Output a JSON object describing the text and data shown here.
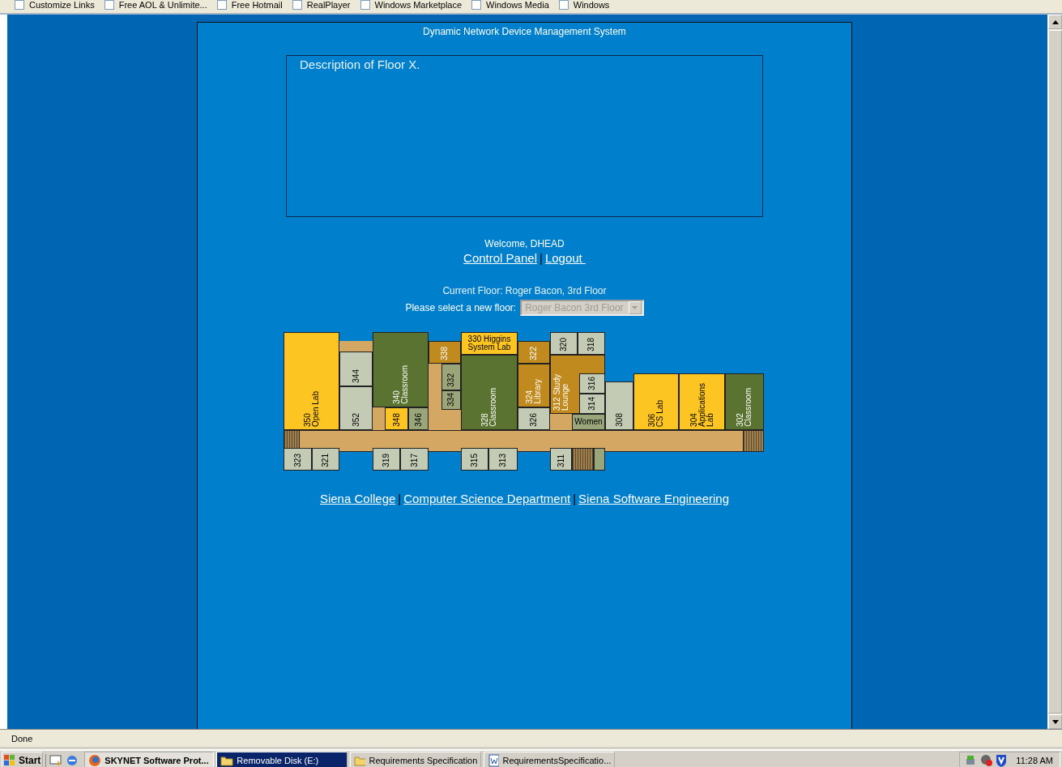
{
  "links_bar": [
    {
      "label": "Customize Links"
    },
    {
      "label": "Free AOL & Unlimite..."
    },
    {
      "label": "Free Hotmail"
    },
    {
      "label": "RealPlayer"
    },
    {
      "label": "Windows Marketplace"
    },
    {
      "label": "Windows Media"
    },
    {
      "label": "Windows"
    }
  ],
  "page": {
    "title": "Dynamic Network Device Management System",
    "description": "Description of Floor X.",
    "welcome": "Welcome, DHEAD",
    "user_links": [
      {
        "label": "Control Panel"
      },
      {
        "label": "Logout "
      }
    ],
    "user_link_separators": [
      "|"
    ],
    "current_floor": "Current Floor: Roger Bacon, 3rd Floor",
    "floor_select": {
      "label": "Please select a new floor:",
      "value": "Roger Bacon 3rd Floor",
      "disabled": true
    },
    "rooms": [
      {
        "lines": [
          "350",
          "Open Lab"
        ],
        "kind": "lab"
      },
      {
        "lines": [
          "344"
        ],
        "kind": "office"
      },
      {
        "lines": [
          "352"
        ],
        "kind": "office"
      },
      {
        "lines": [
          "340",
          "Classroom"
        ],
        "kind": "classroom"
      },
      {
        "lines": [
          "348"
        ],
        "kind": "lab"
      },
      {
        "lines": [
          "346"
        ],
        "kind": "service"
      },
      {
        "lines": [
          "338"
        ],
        "kind": "study"
      },
      {
        "lines": [
          "332"
        ],
        "kind": "service"
      },
      {
        "lines": [
          "334"
        ],
        "kind": "service"
      },
      {
        "lines": [
          "330 Higgins",
          "System Lab"
        ],
        "kind": "lab"
      },
      {
        "lines": [
          "328",
          "Classroom"
        ],
        "kind": "classroom"
      },
      {
        "lines": [
          "322"
        ],
        "kind": "study"
      },
      {
        "lines": [
          "324",
          "Library"
        ],
        "kind": "study"
      },
      {
        "lines": [
          "326"
        ],
        "kind": "office"
      },
      {
        "lines": [
          "320"
        ],
        "kind": "office"
      },
      {
        "lines": [
          "318"
        ],
        "kind": "office"
      },
      {
        "lines": [
          "312 Study",
          "Lounge"
        ],
        "kind": "study"
      },
      {
        "lines": [
          "316"
        ],
        "kind": "office"
      },
      {
        "lines": [
          "314"
        ],
        "kind": "office"
      },
      {
        "lines": [
          "Women"
        ],
        "kind": "service"
      },
      {
        "lines": [
          "308"
        ],
        "kind": "office"
      },
      {
        "lines": [
          "306",
          "CS Lab"
        ],
        "kind": "lab"
      },
      {
        "lines": [
          "304",
          "Applications",
          "Lab"
        ],
        "kind": "lab"
      },
      {
        "lines": [
          "302",
          "Classroom"
        ],
        "kind": "classroom"
      },
      {
        "lines": [
          "323"
        ],
        "kind": "office"
      },
      {
        "lines": [
          "321"
        ],
        "kind": "office"
      },
      {
        "lines": [
          "319"
        ],
        "kind": "office"
      },
      {
        "lines": [
          "317"
        ],
        "kind": "office"
      },
      {
        "lines": [
          "315"
        ],
        "kind": "office"
      },
      {
        "lines": [
          "313"
        ],
        "kind": "office"
      },
      {
        "lines": [
          "311"
        ],
        "kind": "office"
      }
    ],
    "footer_links": [
      {
        "label": "Siena College"
      },
      {
        "label": "Computer Science Department"
      },
      {
        "label": "Siena Software Engineering"
      }
    ],
    "footer_link_separators": [
      "|",
      "|"
    ]
  },
  "status_bar": {
    "text": "Done"
  },
  "taskbar": {
    "start": "Start",
    "tasks": [
      {
        "label": "SKYNET Software Prot...",
        "kind": "browser",
        "active": true,
        "flashing": false
      },
      {
        "label": "Removable Disk (E:)",
        "kind": "folder",
        "active": false,
        "flashing": true
      },
      {
        "label": "Requirements Specification",
        "kind": "folder",
        "active": false,
        "flashing": false
      },
      {
        "label": "RequirementsSpecificatio...",
        "kind": "document",
        "active": false,
        "flashing": false
      }
    ],
    "clock": "11:28 AM"
  }
}
